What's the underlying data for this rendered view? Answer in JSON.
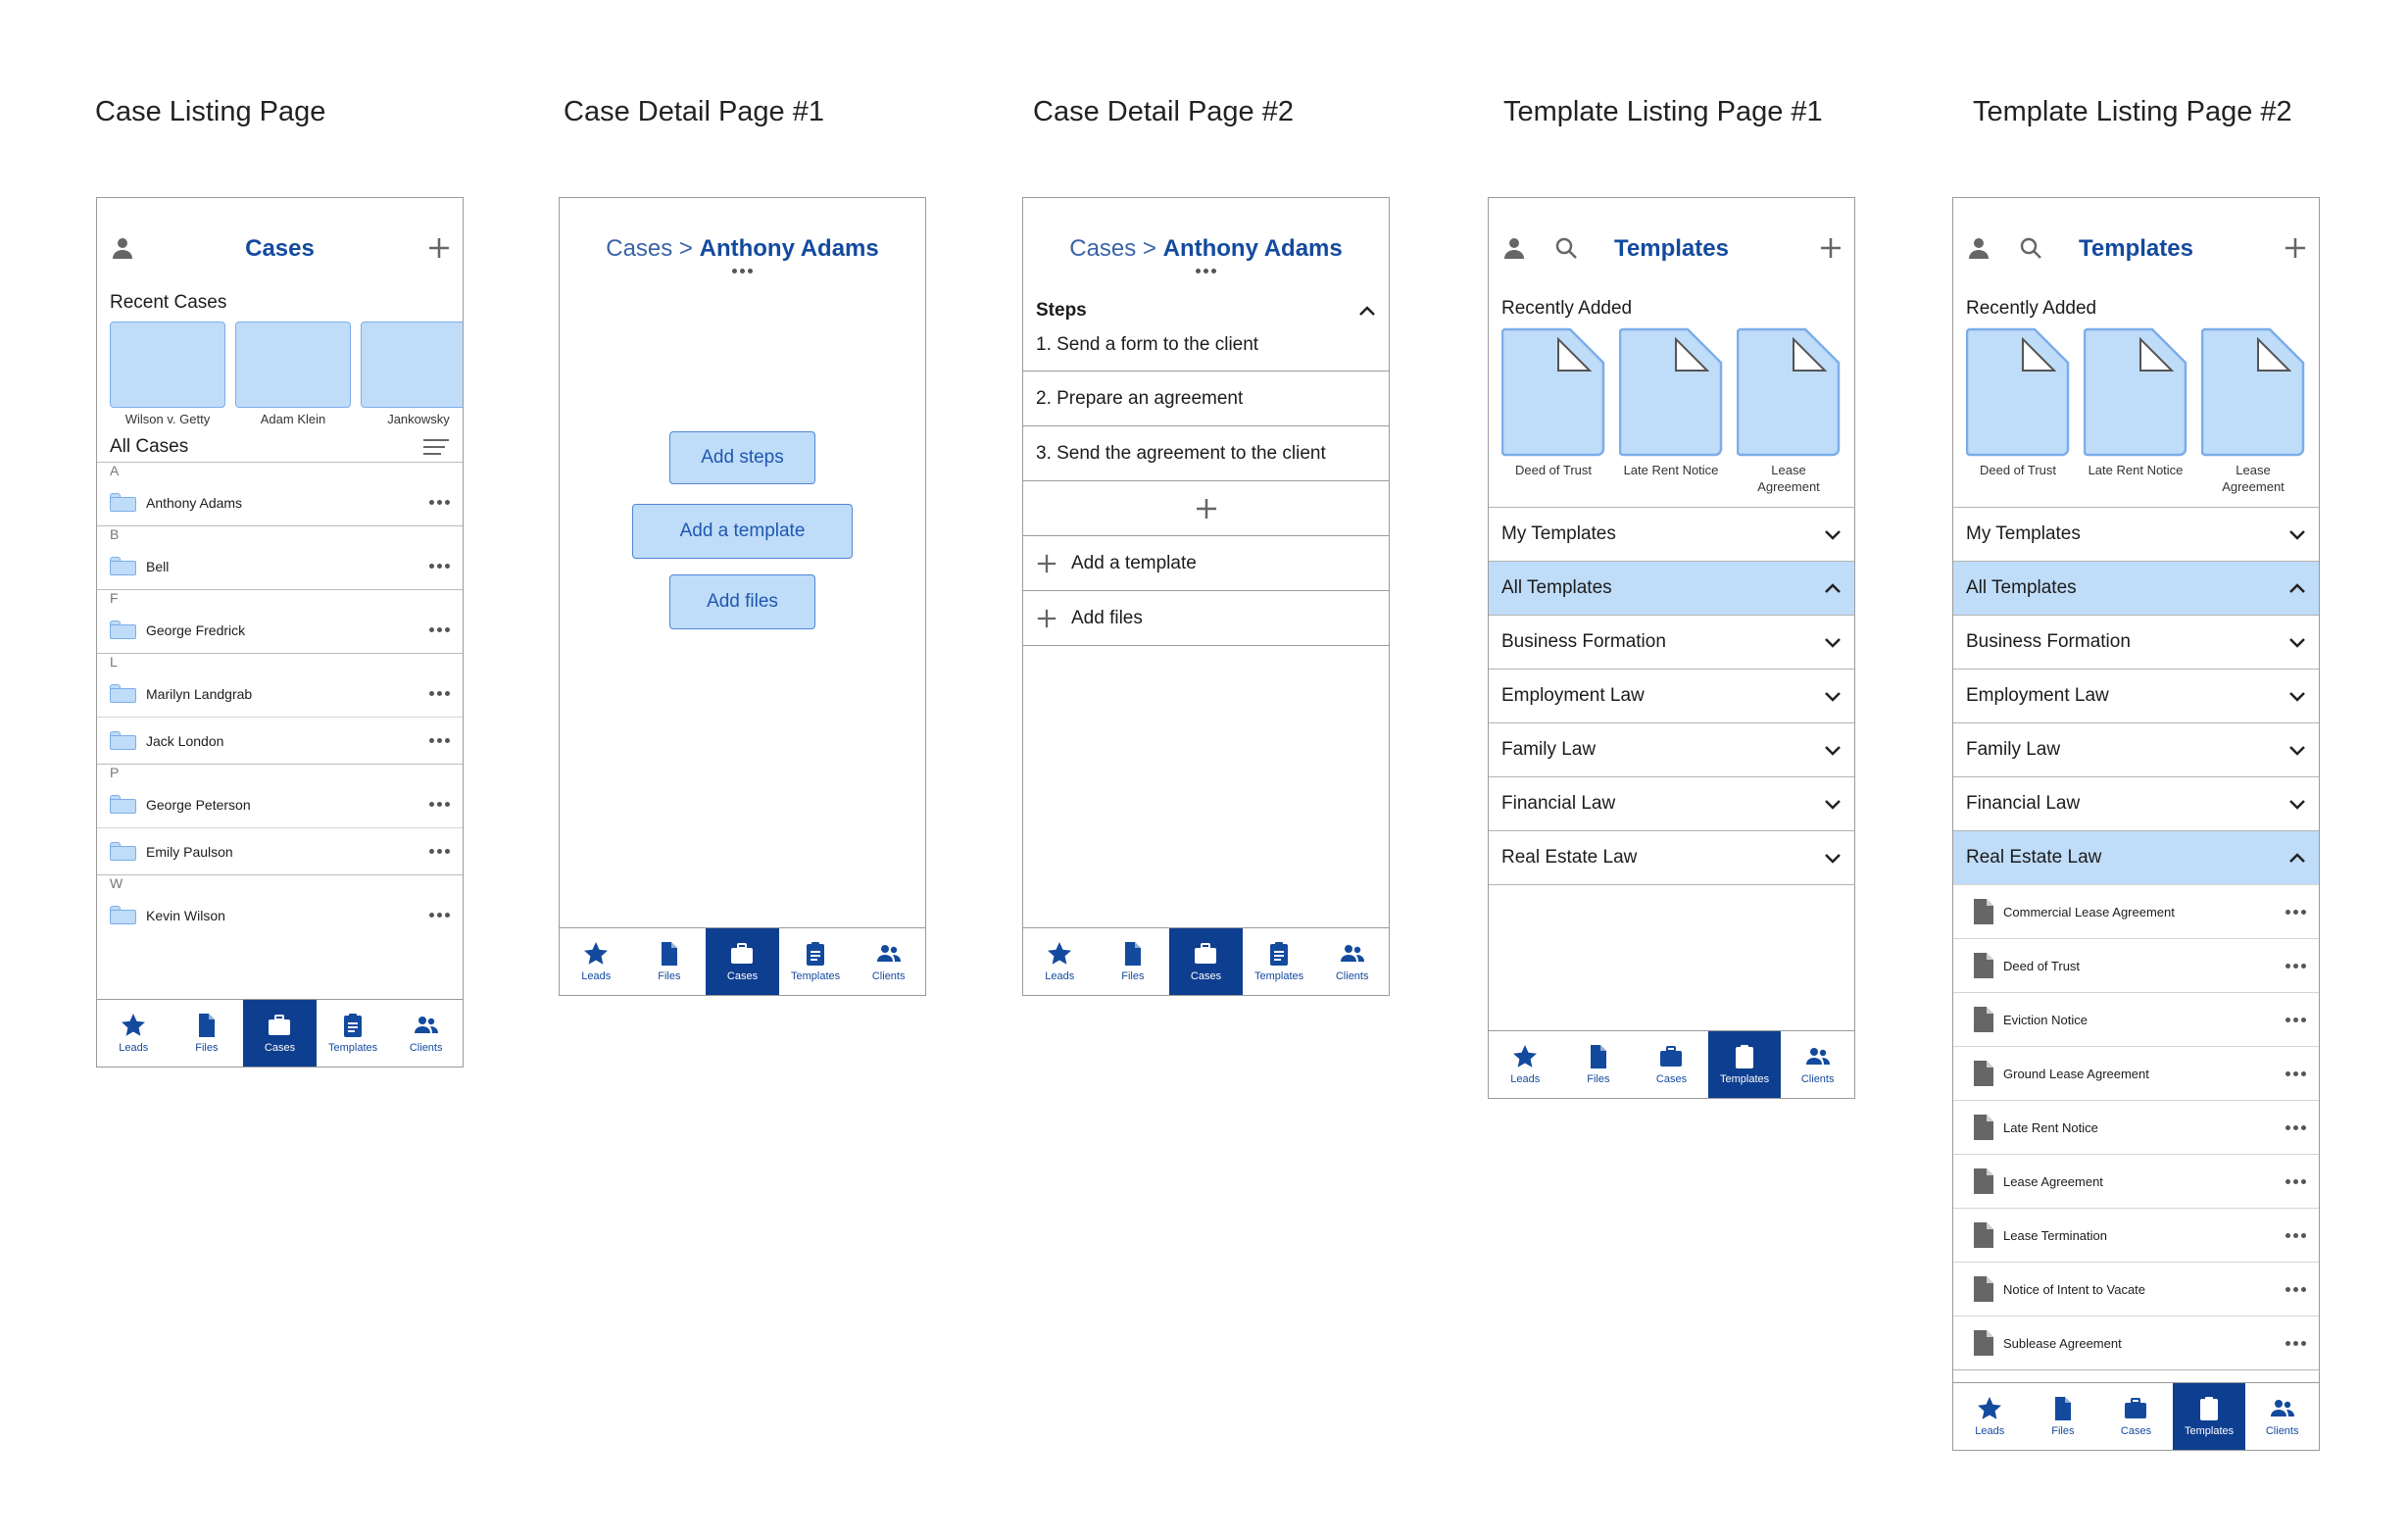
{
  "page_titles": {
    "case_listing": "Case Listing Page",
    "case_detail_1": "Case Detail Page #1",
    "case_detail_2": "Case Detail Page #2",
    "template_listing_1": "Template Listing Page #1",
    "template_listing_2": "Template Listing Page #2"
  },
  "tabs": [
    {
      "label": "Leads",
      "icon": "star-icon"
    },
    {
      "label": "Files",
      "icon": "file-icon"
    },
    {
      "label": "Cases",
      "icon": "briefcase-icon"
    },
    {
      "label": "Templates",
      "icon": "clipboard-icon"
    },
    {
      "label": "Clients",
      "icon": "users-icon"
    }
  ],
  "colors": {
    "brand": "#134a9e",
    "tab_active": "#0e3e8f",
    "tile_fill": "#bfdcf8",
    "tile_border": "#7cadea"
  },
  "case_listing": {
    "title": "Cases",
    "recent_label": "Recent Cases",
    "recent": [
      "Wilson v. Getty",
      "Adam Klein",
      "Jankowsky"
    ],
    "all_label": "All Cases",
    "groups": [
      {
        "letter": "A",
        "items": [
          "Anthony Adams"
        ]
      },
      {
        "letter": "B",
        "items": [
          "Bell"
        ]
      },
      {
        "letter": "F",
        "items": [
          "George Fredrick"
        ]
      },
      {
        "letter": "L",
        "items": [
          "Marilyn Landgrab",
          "Jack London"
        ]
      },
      {
        "letter": "P",
        "items": [
          "George Peterson",
          "Emily Paulson"
        ]
      },
      {
        "letter": "W",
        "items": [
          "Kevin Wilson"
        ]
      }
    ],
    "active_tab": "Cases"
  },
  "breadcrumb": {
    "root": "Cases",
    "separator": " > ",
    "current": "Anthony Adams"
  },
  "case_detail_1": {
    "buttons": [
      "Add steps",
      "Add a template",
      "Add files"
    ],
    "active_tab": "Cases"
  },
  "case_detail_2": {
    "steps_label": "Steps",
    "steps": [
      "1. Send a form to the client",
      "2. Prepare an agreement",
      "3. Send the agreement to the client"
    ],
    "add_template": "Add a template",
    "add_files": "Add files",
    "active_tab": "Cases"
  },
  "templates": {
    "title": "Templates",
    "recent_label": "Recently Added",
    "recent": [
      "Deed of Trust",
      "Late Rent Notice",
      "Lease Agreement"
    ],
    "categories": [
      "My Templates",
      "All Templates",
      "Business Formation",
      "Employment Law",
      "Family Law",
      "Financial Law",
      "Real Estate Law"
    ],
    "open_1": [
      "All Templates"
    ],
    "open_2": [
      "All Templates",
      "Real Estate Law"
    ],
    "real_estate_items": [
      "Commercial Lease Agreement",
      "Deed of Trust",
      "Eviction Notice",
      "Ground Lease Agreement",
      "Late Rent Notice",
      "Lease Agreement",
      "Lease Termination",
      "Notice of Intent to Vacate",
      "Sublease Agreement"
    ],
    "active_tab": "Templates"
  }
}
